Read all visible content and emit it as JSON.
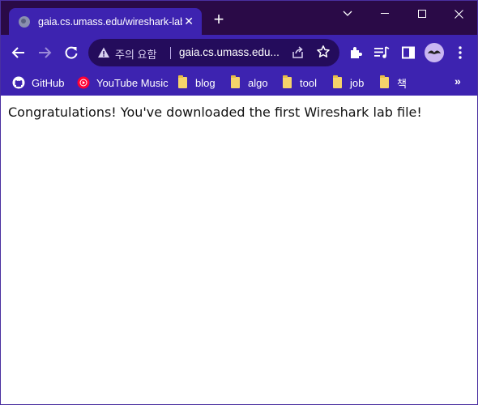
{
  "colors": {
    "titlebar": "#2a0a47",
    "toolbar": "#3d23b0",
    "omnibox": "#240c5c",
    "folder": "#f6d36a"
  },
  "tab": {
    "title": "gaia.cs.umass.edu/wireshark-lab",
    "favicon": "globe-icon",
    "close": "✕"
  },
  "new_tab": "+",
  "window_controls": [
    "chevron-down-icon",
    "minimize-icon",
    "maximize-icon",
    "close-icon"
  ],
  "omnibox": {
    "security_text": "주의 요함",
    "url": "gaia.cs.umass.edu...",
    "icons": [
      "warning-icon",
      "share-icon",
      "star-icon"
    ]
  },
  "toolbar_icons": [
    "back-icon",
    "forward-icon",
    "reload-icon",
    "extensions-icon",
    "media-control-icon",
    "side-panel-icon",
    "profile-avatar",
    "menu-icon"
  ],
  "bookmarks": [
    {
      "label": "GitHub",
      "icon": "github-icon"
    },
    {
      "label": "YouTube Music",
      "icon": "youtube-music-icon"
    },
    {
      "label": "blog",
      "icon": "folder-icon"
    },
    {
      "label": "algo",
      "icon": "folder-icon"
    },
    {
      "label": "tool",
      "icon": "folder-icon"
    },
    {
      "label": "job",
      "icon": "folder-icon"
    },
    {
      "label": "책",
      "icon": "folder-icon"
    }
  ],
  "bookmarks_more": "»",
  "content": {
    "message": "Congratulations! You've downloaded the first Wireshark lab file!"
  }
}
